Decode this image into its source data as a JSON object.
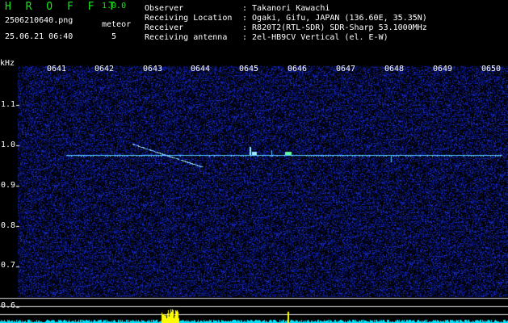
{
  "header": {
    "app_title": "H R O F F T",
    "app_version": "1.0.0",
    "filename": "2506210640.png",
    "datetime": "25.06.21 06:40",
    "meteor_label": "meteor",
    "meteor_count": "5"
  },
  "info": [
    {
      "key": "Observer",
      "value": ": Takanori Kawachi"
    },
    {
      "key": "Receiving Location",
      "value": ": Ogaki, Gifu, JAPAN (136.60E, 35.35N)"
    },
    {
      "key": "Receiver",
      "value": ": R820T2(RTL-SDR) SDR-Sharp 53.1000MHz"
    },
    {
      "key": "Receiving antenna",
      "value": ": 2el-HB9CV Vertical (el. E-W)"
    }
  ],
  "axis": {
    "unit": "kHz",
    "time_ticks": [
      "0641",
      "0642",
      "0643",
      "0644",
      "0645",
      "0646",
      "0647",
      "0648",
      "0649",
      "0650"
    ],
    "freq_ticks": [
      "1.1",
      "1.0",
      "0.9",
      "0.8",
      "0.7",
      "0.6"
    ]
  },
  "colors": {
    "background": "#000000",
    "noise_dark": "#10106a",
    "noise_bright": "#3a46c8",
    "carrier": "#4fc0ff",
    "meteor": "#8ad8ff",
    "grid_line": "#c8c8c8",
    "title_green": "#19e619",
    "level_cyan": "#00e5ff",
    "level_yellow": "#ffff00"
  }
}
